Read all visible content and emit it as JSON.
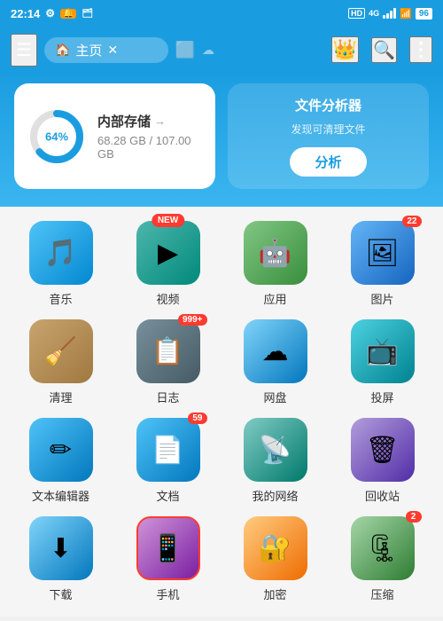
{
  "statusBar": {
    "time": "22:14",
    "battery": "96",
    "icons": [
      "settings",
      "notification",
      "hd",
      "4g",
      "signal",
      "wifi"
    ]
  },
  "toolbar": {
    "hamburger_label": "☰",
    "tab": {
      "home_icon": "🏠",
      "label": "主页",
      "close": "✕"
    },
    "icons": {
      "crown": "👑",
      "search": "🔍",
      "more": "⋮"
    }
  },
  "storageCard": {
    "title": "内部存储",
    "percent": "64%",
    "used": "68.28 GB",
    "total": "107.00 GB",
    "size_display": "68.28 GB / 107.00 GB"
  },
  "analyzerCard": {
    "title": "文件分析器",
    "subtitle": "发现可清理文件",
    "button": "分析"
  },
  "apps": [
    {
      "id": "music",
      "label": "音乐",
      "icon": "🎵",
      "color": "icon-music",
      "badge": null,
      "badge_new": false
    },
    {
      "id": "video",
      "label": "视频",
      "icon": "▶",
      "color": "icon-video",
      "badge": null,
      "badge_new": true
    },
    {
      "id": "app",
      "label": "应用",
      "icon": "🤖",
      "color": "icon-app",
      "badge": null,
      "badge_new": false
    },
    {
      "id": "photo",
      "label": "图片",
      "icon": "🖼",
      "color": "icon-photo",
      "badge": "22",
      "badge_new": false
    },
    {
      "id": "clean",
      "label": "清理",
      "icon": "🧹",
      "color": "icon-clean",
      "badge": null,
      "badge_new": false
    },
    {
      "id": "log",
      "label": "日志",
      "icon": "📋",
      "color": "icon-log",
      "badge": "999+",
      "badge_new": false
    },
    {
      "id": "cloud",
      "label": "网盘",
      "icon": "☁",
      "color": "icon-cloud",
      "badge": null,
      "badge_new": false
    },
    {
      "id": "cast",
      "label": "投屏",
      "icon": "📺",
      "color": "icon-cast",
      "badge": null,
      "badge_new": false
    },
    {
      "id": "texteditor",
      "label": "文本编辑器",
      "icon": "✏",
      "color": "icon-text",
      "badge": null,
      "badge_new": false
    },
    {
      "id": "doc",
      "label": "文档",
      "icon": "📄",
      "color": "icon-doc",
      "badge": "59",
      "badge_new": false
    },
    {
      "id": "network",
      "label": "我的网络",
      "icon": "📡",
      "color": "icon-network",
      "badge": null,
      "badge_new": false
    },
    {
      "id": "trash",
      "label": "回收站",
      "icon": "🗑",
      "color": "icon-trash",
      "badge": null,
      "badge_new": false
    },
    {
      "id": "download",
      "label": "下载",
      "icon": "⬇",
      "color": "icon-download",
      "badge": null,
      "badge_new": false
    },
    {
      "id": "phone",
      "label": "手机",
      "icon": "📱",
      "color": "icon-phone",
      "badge": null,
      "badge_new": false
    },
    {
      "id": "lock",
      "label": "加密",
      "icon": "🔐",
      "color": "icon-lock",
      "badge": null,
      "badge_new": false
    },
    {
      "id": "zip",
      "label": "压缩",
      "icon": "🗜",
      "color": "icon-zip",
      "badge": "2",
      "badge_new": false
    }
  ],
  "donut": {
    "radius": 26,
    "stroke": 8,
    "percent": 64
  }
}
